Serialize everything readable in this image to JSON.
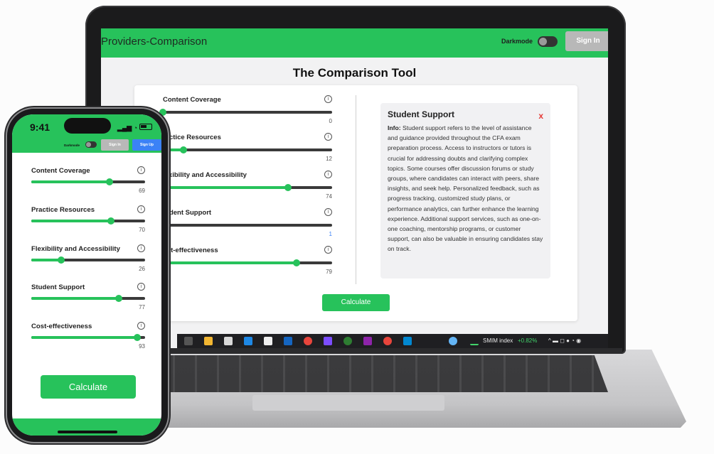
{
  "laptop": {
    "brand": "Providers-Comparison",
    "darkmode_label": "Darkmode",
    "signin_label": "Sign In",
    "page_title": "The Comparison Tool",
    "sliders": [
      {
        "label": "Content Coverage",
        "value": "0",
        "level": 0.0
      },
      {
        "label": "ractice Resources",
        "value": "12",
        "level": 0.12
      },
      {
        "label": "lexibility and Accessibility",
        "value": "74",
        "level": 0.74
      },
      {
        "label": "tudent Support",
        "value": "1",
        "level": 0.01
      },
      {
        "label": "ost-effectiveness",
        "value": "79",
        "level": 0.79
      }
    ],
    "info": {
      "title": "Student Support",
      "close": "x",
      "prefix": "Info:",
      "body": " Student support refers to the level of assistance and guidance provided throughout the CFA exam preparation process. Access to instructors or tutors is crucial for addressing doubts and clarifying complex topics. Some courses offer discussion forums or study groups, where candidates can interact with peers, share insights, and seek help. Personalized feedback, such as progress tracking, customized study plans, or performance analytics, can further enhance the learning experience. Additional support services, such as one-on-one coaching, mentorship programs, or customer support, can also be valuable in ensuring candidates stay on track."
    },
    "calculate_label": "Calculate",
    "taskbar": {
      "stock_label": "SMIM index",
      "stock_change": "+0.82%"
    }
  },
  "phone": {
    "time": "9:41",
    "darkmode_label": "Darkmode",
    "signin_label": "Sign In",
    "signup_label": "Sign Up",
    "sliders": [
      {
        "label": "Content Coverage",
        "value": "69",
        "level": 0.69
      },
      {
        "label": "Practice Resources",
        "value": "70",
        "level": 0.7
      },
      {
        "label": "Flexibility and Accessibility",
        "value": "26",
        "level": 0.26
      },
      {
        "label": "Student Support",
        "value": "77",
        "level": 0.77
      },
      {
        "label": "Cost-effectiveness",
        "value": "93",
        "level": 0.93
      }
    ],
    "calculate_label": "Calculate"
  },
  "colors": {
    "accent": "#27c25b",
    "signup": "#3b82f6",
    "close": "#e53935"
  }
}
